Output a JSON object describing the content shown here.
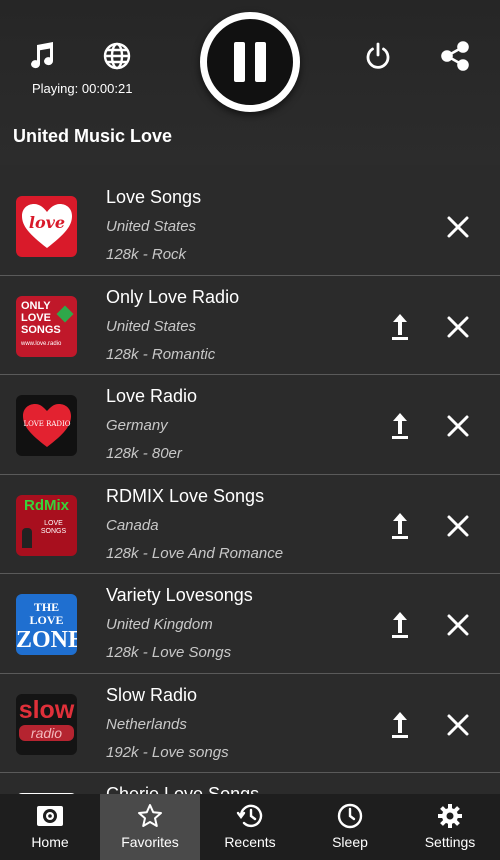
{
  "header": {
    "playing_text": "Playing: 00:00:21",
    "list_title": "United Music Love",
    "icons": [
      "music-note-icon",
      "globe-icon",
      "pause-icon",
      "power-icon",
      "share-icon"
    ]
  },
  "stations": [
    {
      "name": "Love Songs",
      "country": "United States",
      "meta": "128k - Rock",
      "logo_text": "love",
      "logo_bg": "#d91a2a"
    },
    {
      "name": "Only Love Radio",
      "country": "United States",
      "meta": "128k - Romantic",
      "logo_text": "ONLY LOVE SONGS",
      "logo_sub": "www.love.radio",
      "logo_bg": "#c0182a"
    },
    {
      "name": "Love Radio",
      "country": "Germany",
      "meta": "128k - 80er",
      "logo_text": "LOVE RADIO",
      "logo_bg": "#111111"
    },
    {
      "name": "RDMIX Love Songs",
      "country": "Canada",
      "meta": "128k - Love And Romance",
      "logo_text": "RdMix",
      "logo_sub": "LOVE SONGS",
      "logo_bg": "#a80f1e"
    },
    {
      "name": "Variety Lovesongs",
      "country": "United Kingdom",
      "meta": "128k - Love Songs",
      "logo_text": "THE LOVE",
      "logo_sub": "ZONE",
      "logo_bg": "#1f6fd0"
    },
    {
      "name": "Slow Radio",
      "country": "Netherlands",
      "meta": "192k - Love songs",
      "logo_text": "slow",
      "logo_sub": "radio",
      "logo_bg": "#141414"
    },
    {
      "name": "Cherie Love Songs",
      "country": "",
      "meta": "",
      "logo_text": "",
      "logo_bg": "#ffffff"
    }
  ],
  "nav": [
    {
      "label": "Home",
      "icon": "radio-icon"
    },
    {
      "label": "Favorites",
      "icon": "star-icon"
    },
    {
      "label": "Recents",
      "icon": "history-icon"
    },
    {
      "label": "Sleep",
      "icon": "clock-icon"
    },
    {
      "label": "Settings",
      "icon": "gear-icon"
    }
  ],
  "colors": {
    "active_nav": "#4a4a4a",
    "background": "#2b2b2b",
    "nav_bg": "#1e1e1e"
  }
}
